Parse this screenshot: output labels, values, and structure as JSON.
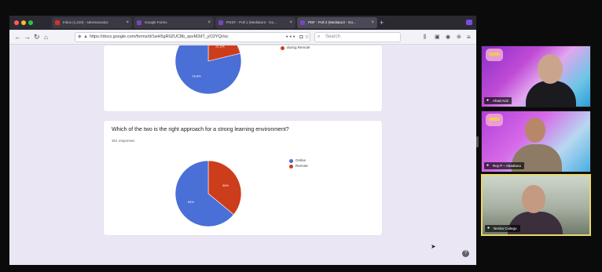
{
  "browser": {
    "tabs": [
      {
        "label": "Inbox (1,210) - selvimacedoc",
        "favicon_color": "#d93025",
        "active": false
      },
      {
        "label": "Google Forms",
        "favicon_color": "#7248b9",
        "active": false
      },
      {
        "label": "POST - Poll 1 (Mediator2 - Go...",
        "favicon_color": "#7248b9",
        "active": false
      },
      {
        "label": "PDF - Poll 2 (Mediator2 - Go...",
        "favicon_color": "#7248b9",
        "active": true
      }
    ],
    "new_tab_label": "+",
    "url": "https://docs.google.com/forms/d/1wH5gR0ZUC8b_qsvM2dT_yO2YQr/sc",
    "url_more": "•••",
    "search_placeholder": "Search",
    "icons": [
      "back-icon",
      "forward-icon",
      "reload-icon",
      "home-icon",
      "shield-icon",
      "lock-icon",
      "bookmark-star-icon",
      "library-icon",
      "sidebar-icon",
      "extension-icon",
      "account-icon",
      "menu-icon"
    ]
  },
  "form": {
    "card1": {
      "legend": [
        {
          "label": "during Remote",
          "color": "#cc3d1c"
        }
      ]
    },
    "card2": {
      "question": "Which of the two is the right approach for a strong learning environment?",
      "responses": "361 responses",
      "legend": [
        {
          "label": "Online",
          "color": "#4a6fd6"
        },
        {
          "label": "Remote",
          "color": "#cc3d1c"
        }
      ]
    }
  },
  "chart_data": [
    {
      "type": "pie",
      "slices": [
        {
          "label": "",
          "value": 78.8,
          "color": "#4a6fd6"
        },
        {
          "label": "",
          "value": 21.2,
          "color": "#cc3d1c"
        }
      ],
      "value_labels": [
        "78.8%",
        "21.2%"
      ],
      "legend": [
        "during Remote"
      ]
    },
    {
      "type": "pie",
      "title": "Which of the two is the right approach for a strong learning environment?",
      "slices": [
        {
          "label": "Online",
          "value": 64,
          "color": "#4a6fd6"
        },
        {
          "label": "Remote",
          "value": 36,
          "color": "#cc3d1c"
        }
      ],
      "value_labels": [
        "64%",
        "36%"
      ],
      "legend": [
        "Online",
        "Remote"
      ]
    }
  ],
  "participants": [
    {
      "name": "Ahad Aziz",
      "speaking": false
    },
    {
      "name": "Roy P – Abadiano",
      "speaking": false
    },
    {
      "name": "Nenita Cuilego",
      "speaking": true
    }
  ],
  "help_label": "?",
  "colors": {
    "online": "#4a6fd6",
    "remote": "#cc3d1c",
    "speaking_border": "#e8d86b"
  }
}
